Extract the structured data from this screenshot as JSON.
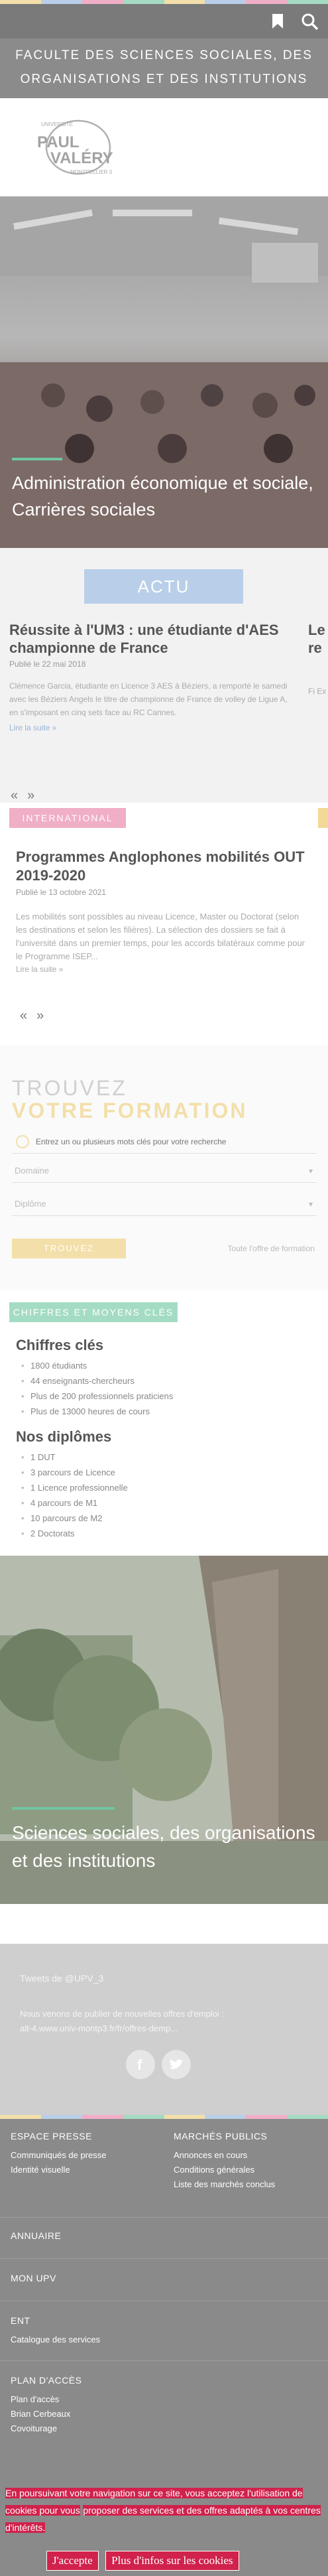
{
  "colors": {
    "stripe": [
      "#f3dfa9",
      "#b9cfe9",
      "#f0aec7",
      "#a4dcc3",
      "#f3dfa9",
      "#b9cfe9",
      "#f0aec7",
      "#a4dcc3"
    ],
    "accent_green": "#6ec6a0",
    "cookie_red": "#d0224c"
  },
  "header": {
    "faculty_line1": "Faculte des sciences sociales, des",
    "faculty_line2": "organisations et des institutions",
    "logo_text_top": "UNIVERSITÉ",
    "logo_text_main1": "PAUL",
    "logo_text_main2": "VALÉRY",
    "logo_text_bottom": "MONTPELLIER 3"
  },
  "hero": {
    "caption": "Administration économique et sociale, Carrières sociales"
  },
  "actu": {
    "section_title": "ACTU",
    "card": {
      "title": "Réussite à l'UM3 : une étudiante d'AES championne de France",
      "date": "Publié le 22 mai 2018",
      "body": "Clémence Garcia, étudiante en Licence 3 AES à Béziers, a remporté le samedi avec les Béziers Angels le titre de championne de France de volley de Ligue A, en s'imposant en cinq sets face au RC Cannes.",
      "more": "Lire la suite »"
    },
    "peek_title": "Le re",
    "peek_body": "Fi Ex",
    "pager_prev": "«",
    "pager_next": "»"
  },
  "international": {
    "tag": "INTERNATIONAL",
    "card": {
      "title": "Programmes Anglophones mobilités OUT 2019-2020",
      "date": "Publié le 13 octobre 2021",
      "body": "Les mobilités sont possibles au niveau Licence, Master ou Doctorat (selon les destinations et selon les filières). La sélection des dossiers se fait à l'université dans un premier temps, pour les accords bilatéraux comme pour le Programme ISEP...",
      "more": "Lire la suite »"
    },
    "pager_prev": "«",
    "pager_next": "»"
  },
  "search": {
    "title_line1": "TROUVEZ",
    "title_line2": "VOTRE FORMATION",
    "keyword_placeholder": "Entrez un ou plusieurs mots clés pour votre recherche",
    "domain_label": "Domaine",
    "diploma_label": "Diplôme",
    "button_label": "TROUVEZ",
    "all_link": "Toute l'offre de formation"
  },
  "figures": {
    "tag": "CHIFFRES ET MOYENS CLÉS",
    "key_title": "Chiffres clés",
    "key_items": [
      "1800 étudiants",
      "44 enseignants-chercheurs",
      "Plus de 200 professionnels praticiens",
      "Plus de 13000 heures de cours"
    ],
    "diploma_title": "Nos diplômes",
    "diploma_items": [
      "1 DUT",
      "3 parcours de Licence",
      "1 Licence professionnelle",
      "4 parcours de M1",
      "10 parcours de M2",
      "2 Doctorats"
    ]
  },
  "promo": {
    "caption": "Sciences sociales, des organisations et des institutions"
  },
  "social": {
    "tweets_label": "Tweets de @UPV_3",
    "tweet_line1": "Nous venons de publier de nouvelles offres d'emploi :",
    "tweet_line2": "alt-4.www.univ-montp3.fr/fr/offres-demp...",
    "icons": [
      "facebook-icon",
      "twitter-icon"
    ]
  },
  "footer": {
    "espace_presse": {
      "title": "ESPACE PRESSE",
      "items": [
        "Communiqués de presse",
        "Identité visuelle"
      ]
    },
    "marches_publics": {
      "title": "MARCHÉS PUBLICS",
      "items": [
        "Annonces en cours",
        "Conditions générales",
        "Liste des marchés conclus"
      ]
    },
    "annuaire": {
      "title": "ANNUAIRE"
    },
    "mon_upv": {
      "title": "MON UPV"
    },
    "ent": {
      "title": "ENT",
      "items": [
        "Catalogue des services"
      ]
    },
    "plan": {
      "title": "PLAN D'ACCÈS",
      "items": [
        "Plan d'accès",
        "Brian Cerbeaux",
        "Covoiturage"
      ]
    }
  },
  "cookie": {
    "text_line1": "En poursuivant votre navigation sur ce site, vous acceptez l'utilisation de cookies pour vous",
    "text_line2": "proposer des services et des offres adaptés à vos centres d'intérêts.",
    "accept": "J'accepte",
    "more": "Plus d'infos sur les cookies"
  }
}
